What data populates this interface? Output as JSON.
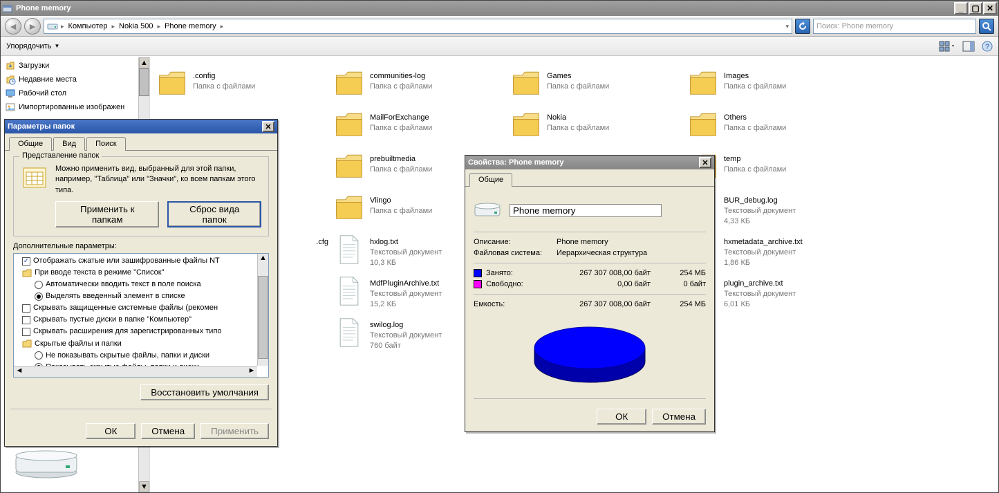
{
  "window": {
    "title": "Phone memory"
  },
  "nav": {
    "crumbs": [
      "Компьютер",
      "Nokia 500",
      "Phone memory"
    ],
    "search_placeholder": "Поиск: Phone memory"
  },
  "toolbar": {
    "organize": "Упорядочить"
  },
  "sidebar": {
    "items": [
      {
        "label": "Загрузки",
        "icon": "downloads"
      },
      {
        "label": "Недавние места",
        "icon": "recent"
      },
      {
        "label": "Рабочий стол",
        "icon": "desktop"
      },
      {
        "label": "Импортированные изображен",
        "icon": "pictures"
      }
    ]
  },
  "content": {
    "items": [
      {
        "col": 0,
        "row": 0,
        "kind": "folder",
        "name": ".config",
        "meta": "Папка с файлами"
      },
      {
        "col": 1,
        "row": 0,
        "kind": "folder",
        "name": "communities-log",
        "meta": "Папка с файлами"
      },
      {
        "col": 2,
        "row": 0,
        "kind": "folder",
        "name": "Games",
        "meta": "Папка с файлами"
      },
      {
        "col": 3,
        "row": 0,
        "kind": "folder",
        "name": "Images",
        "meta": "Папка с файлами"
      },
      {
        "col": 1,
        "row": 1,
        "kind": "folder",
        "name": "MailForExchange",
        "meta": "Папка с файлами"
      },
      {
        "col": 2,
        "row": 1,
        "kind": "folder",
        "name": "Nokia",
        "meta": "Папка с файлами"
      },
      {
        "col": 3,
        "row": 1,
        "kind": "folder",
        "name": "Others",
        "meta": "Папка с файлами"
      },
      {
        "col": 1,
        "row": 2,
        "kind": "folder",
        "name": "prebuiltmedia",
        "meta": "Папка с файлами"
      },
      {
        "col": 3,
        "row": 2,
        "kind": "folder",
        "name": "temp",
        "meta": "Папка с файлами"
      },
      {
        "col": 1,
        "row": 3,
        "kind": "folder",
        "name": "Vlingo",
        "meta": "Папка с файлами"
      },
      {
        "col": 3,
        "row": 3,
        "kind": "text",
        "name": "BUR_debug.log",
        "meta1": "Текстовый документ",
        "meta2": "4,33 КБ"
      },
      {
        "col": 0,
        "row": 4,
        "kind": "text-frag",
        "name": ".cfg",
        "meta": ""
      },
      {
        "col": 1,
        "row": 4,
        "kind": "text",
        "name": "hxlog.txt",
        "meta1": "Текстовый документ",
        "meta2": "10,3 КБ"
      },
      {
        "col": 3,
        "row": 4,
        "kind": "text",
        "name": "hxmetadata_archive.txt",
        "meta1": "Текстовый документ",
        "meta2": "1,86 КБ"
      },
      {
        "col": 1,
        "row": 5,
        "kind": "text",
        "name": "MdfPluginArchive.txt",
        "meta1": "Текстовый документ",
        "meta2": "15,2 КБ"
      },
      {
        "col": 3,
        "row": 5,
        "kind": "text",
        "name": "plugin_archive.txt",
        "meta1": "Текстовый документ",
        "meta2": "6,01 КБ"
      },
      {
        "col": 1,
        "row": 6,
        "kind": "text",
        "name": "swilog.log",
        "meta1": "Текстовый документ",
        "meta2": "760 байт"
      }
    ]
  },
  "folderOptions": {
    "title": "Параметры папок",
    "tabs": [
      "Общие",
      "Вид",
      "Поиск"
    ],
    "active_tab": 1,
    "group_title": "Представление папок",
    "group_text": "Можно применить вид, выбранный для этой папки, например, \"Таблица\" или \"Значки\", ко всем папкам этого типа.",
    "apply_to_folders": "Применить к папкам",
    "reset_folders": "Сброс вида папок",
    "adv_label": "Дополнительные параметры:",
    "tree": [
      {
        "kind": "check",
        "sel": true,
        "text": "Отображать сжатые или зашифрованные файлы NT",
        "indent": 0
      },
      {
        "kind": "folder",
        "text": "При вводе текста в режиме \"Список\"",
        "indent": 0
      },
      {
        "kind": "radio",
        "sel": false,
        "text": "Автоматически вводить текст в поле поиска",
        "indent": 1
      },
      {
        "kind": "radio",
        "sel": true,
        "text": "Выделять введенный элемент в списке",
        "indent": 1
      },
      {
        "kind": "check",
        "sel": false,
        "text": "Скрывать защищенные системные файлы (рекомен",
        "indent": 0
      },
      {
        "kind": "check",
        "sel": false,
        "text": "Скрывать пустые диски в папке \"Компьютер\"",
        "indent": 0
      },
      {
        "kind": "check",
        "sel": false,
        "text": "Скрывать расширения для зарегистрированных типо",
        "indent": 0
      },
      {
        "kind": "folder",
        "text": "Скрытые файлы и папки",
        "indent": 0
      },
      {
        "kind": "radio",
        "sel": false,
        "text": "Не показывать скрытые файлы, папки и диски",
        "indent": 1
      },
      {
        "kind": "radio",
        "sel": true,
        "text": "Показывать скрытые файлы, папки и диски",
        "indent": 1
      }
    ],
    "restore_defaults": "Восстановить умолчания",
    "ok": "ОК",
    "cancel": "Отмена",
    "apply": "Применить"
  },
  "props": {
    "title": "Свойства: Phone memory",
    "tab": "Общие",
    "drive_name": "Phone memory",
    "description_label": "Описание:",
    "description": "Phone memory",
    "fs_label": "Файловая система:",
    "fs": "Иерархическая структура",
    "used_label": "Занято:",
    "used_bytes": "267 307 008,00 байт",
    "used_human": "254 МБ",
    "free_label": "Свободно:",
    "free_bytes": "0,00 байт",
    "free_human": "0 байт",
    "capacity_label": "Емкость:",
    "capacity_bytes": "267 307 008,00 байт",
    "capacity_human": "254 МБ",
    "ok": "ОК",
    "cancel": "Отмена"
  },
  "colors": {
    "used": "#0000ff",
    "free": "#ff00ff"
  },
  "chart_data": {
    "type": "pie",
    "series": [
      {
        "name": "Занято",
        "value": 267307008
      },
      {
        "name": "Свободно",
        "value": 0
      }
    ],
    "title": "",
    "legend": [
      "Занято",
      "Свободно"
    ]
  }
}
